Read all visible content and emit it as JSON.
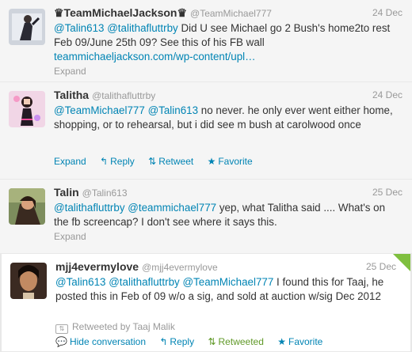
{
  "tweets": [
    {
      "fullname": "♛TeamMichaelJackson♛",
      "username": "@TeamMichael777",
      "timestamp": "24 Dec",
      "text_parts": [
        {
          "t": "@Talin613",
          "k": "mention"
        },
        {
          "t": " ",
          "k": "plain"
        },
        {
          "t": "@talithafluttrby",
          "k": "mention"
        },
        {
          "t": " Did U see Michael go 2 Bush's home2to rest Feb 09/June 25th 09? See this of his FB wall ",
          "k": "plain"
        },
        {
          "t": "teammichaeljackson.com/wp-content/upl…",
          "k": "link"
        }
      ],
      "expand_label": "Expand"
    },
    {
      "fullname": "Talitha",
      "username": "@talithafluttrby",
      "timestamp": "24 Dec",
      "text_parts": [
        {
          "t": "@TeamMichael777",
          "k": "mention"
        },
        {
          "t": " ",
          "k": "plain"
        },
        {
          "t": "@Talin613",
          "k": "mention"
        },
        {
          "t": " no never. he only ever went either home, shopping, or to rehearsal, but i did see m bush at carolwood once",
          "k": "plain"
        }
      ],
      "expand_label": "Expand",
      "reply_label": "Reply",
      "retweet_label": "Retweet",
      "favorite_label": "Favorite"
    },
    {
      "fullname": "Talin",
      "username": "@Talin613",
      "timestamp": "25 Dec",
      "text_parts": [
        {
          "t": "@talithafluttrby",
          "k": "mention"
        },
        {
          "t": " ",
          "k": "plain"
        },
        {
          "t": "@teammichael777",
          "k": "mention"
        },
        {
          "t": " yep, what Talitha said .... What's on the fb screencap? I don't see where it says this.",
          "k": "plain"
        }
      ],
      "expand_label": "Expand"
    },
    {
      "fullname": "mjj4evermylove",
      "username": "@mjj4evermylove",
      "timestamp": "25 Dec",
      "text_parts": [
        {
          "t": "@Talin613",
          "k": "mention"
        },
        {
          "t": " ",
          "k": "plain"
        },
        {
          "t": "@talithafluttrby",
          "k": "mention"
        },
        {
          "t": " ",
          "k": "plain"
        },
        {
          "t": "@TeamMichael777",
          "k": "mention"
        },
        {
          "t": " I found this for Taaj, he posted this in Feb of 09 w/o a sig, and sold at auction w/sig Dec 2012",
          "k": "plain"
        }
      ],
      "retweeted_by": "Retweeted by Taaj Malik",
      "hide_label": "Hide conversation",
      "reply_label": "Reply",
      "retweeted_label": "Retweeted",
      "favorite_label": "Favorite"
    }
  ],
  "icons": {
    "reply": "reply-icon",
    "retweet": "retweet-icon",
    "favorite": "star-icon",
    "hide": "conversation-icon"
  },
  "colors": {
    "link": "#0084b4",
    "muted": "#999999",
    "retweeted": "#609928",
    "corner": "#7fbf3f"
  }
}
